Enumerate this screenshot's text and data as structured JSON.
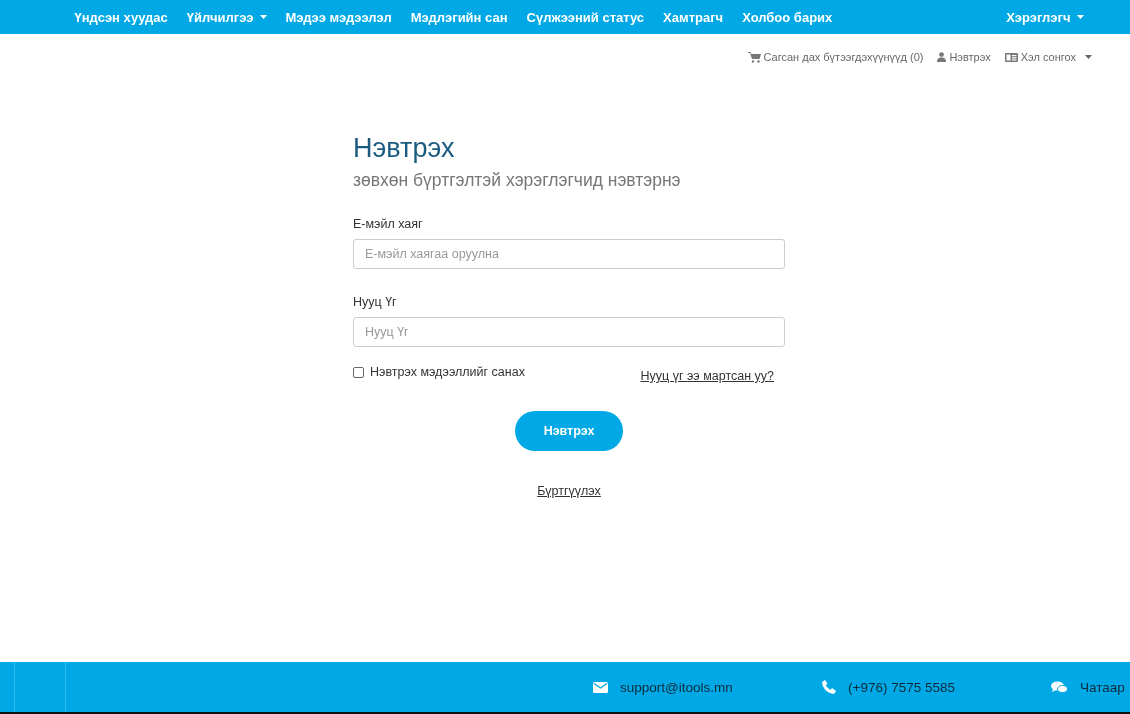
{
  "navbar": {
    "items": [
      {
        "label": "Үндсэн хуудас",
        "dropdown": false
      },
      {
        "label": "Үйлчилгээ",
        "dropdown": true
      },
      {
        "label": "Мэдээ мэдээлэл",
        "dropdown": false
      },
      {
        "label": "Мэдлэгийн сан",
        "dropdown": false
      },
      {
        "label": "Сүлжээний статус",
        "dropdown": false
      },
      {
        "label": "Хамтрагч",
        "dropdown": false
      },
      {
        "label": "Холбоо барих",
        "dropdown": false
      }
    ],
    "user_menu": {
      "label": "Хэрэглэгч",
      "dropdown": true
    }
  },
  "top_links": [
    {
      "kind": "cart",
      "label": "Сагсан дах бүтээгдэхүүнүүд (0)",
      "dropdown": false
    },
    {
      "kind": "login",
      "label": "Нэвтрэх",
      "dropdown": false
    },
    {
      "kind": "language",
      "label": "Хэл сонгох",
      "dropdown": true
    }
  ],
  "login": {
    "title": "Нэвтрэх",
    "subtitle": "зөвхөн бүртгэлтэй хэрэглэгчид нэвтэрнэ",
    "fields": [
      {
        "label": "Е-мэйл хаяг",
        "placeholder": "Е-мэйл хаягаа оруулна"
      },
      {
        "label": "Нууц Үг",
        "placeholder": "Нууц Үг"
      }
    ],
    "remember": {
      "label": "Нэвтрэх мэдээллийг санах",
      "checked": false
    },
    "forgot_link": "Нууц үг ээ мартсан уу?",
    "submit": "Нэвтрэх",
    "register_link": "Бүртгүүлэх"
  },
  "footer": {
    "contacts": [
      {
        "kind": "email",
        "text": "support@itools.mn"
      },
      {
        "kind": "phone",
        "text": "(+976) 7575 5585"
      },
      {
        "kind": "chat",
        "text": "Чатаар"
      }
    ]
  }
}
